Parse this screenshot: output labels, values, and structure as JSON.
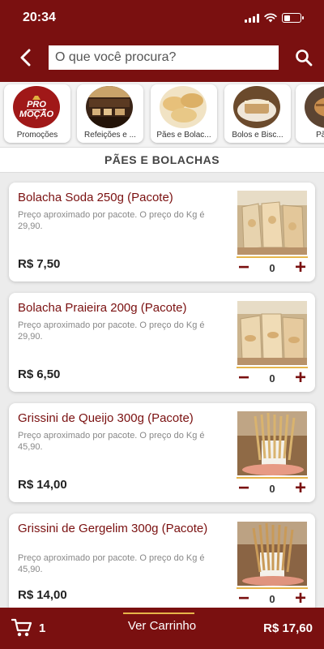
{
  "status_bar": {
    "time": "20:34"
  },
  "search": {
    "placeholder": "O que você procura?"
  },
  "categories": [
    {
      "label": "Promoções",
      "badge_line1": "PRO",
      "badge_line2": "MOÇÃO"
    },
    {
      "label": "Refeições e ..."
    },
    {
      "label": "Pães e Bolac..."
    },
    {
      "label": "Bolos e Bisc..."
    },
    {
      "label": "Pães A"
    }
  ],
  "section_title": "PÃES E BOLACHAS",
  "currency": "R$",
  "products": [
    {
      "name": "Bolacha Soda 250g (Pacote)",
      "description": "Preço aproximado por pacote. O preço do Kg é 29,90.",
      "price": "7,50",
      "quantity": "0"
    },
    {
      "name": "Bolacha Praieira 200g (Pacote)",
      "description": "Preço aproximado por pacote. O preço do Kg é 29,90.",
      "price": "6,50",
      "quantity": "0"
    },
    {
      "name": "Grissini de Queijo 300g (Pacote)",
      "description": "Preço aproximado por pacote. O preço do Kg é 45,90.",
      "price": "14,00",
      "quantity": "0"
    },
    {
      "name": "Grissini de Gergelim 300g (Pacote)",
      "description": "Preço aproximado por pacote. O preço do Kg é 45,90.",
      "price": "14,00",
      "quantity": "0"
    }
  ],
  "cart": {
    "count": "1",
    "view_label": "Ver Carrinho",
    "total": "R$ 17,60"
  },
  "colors": {
    "brand": "#7a1010",
    "accent": "#e6b54a"
  },
  "icons": [
    "back-arrow-icon",
    "search-icon",
    "minus-icon",
    "plus-icon",
    "cart-icon"
  ]
}
